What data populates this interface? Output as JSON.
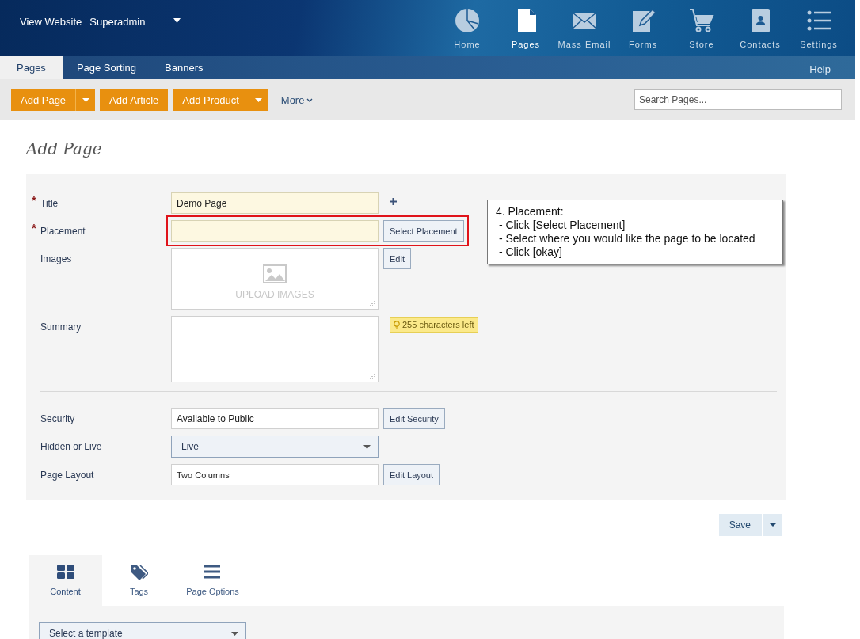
{
  "header": {
    "links": [
      "View Website",
      "Superadmin"
    ],
    "nav": [
      {
        "label": "Home",
        "selected": false
      },
      {
        "label": "Pages",
        "selected": true
      },
      {
        "label": "Mass Email",
        "selected": false
      },
      {
        "label": "Forms",
        "selected": false
      },
      {
        "label": "Store",
        "selected": false
      },
      {
        "label": "Contacts",
        "selected": false
      },
      {
        "label": "Settings",
        "selected": false
      }
    ]
  },
  "subnav": {
    "tabs": [
      {
        "label": "Pages",
        "selected": true
      },
      {
        "label": "Page Sorting",
        "selected": false
      },
      {
        "label": "Banners",
        "selected": false
      }
    ],
    "help": "Help"
  },
  "toolbar": {
    "buttons": [
      {
        "label": "Add Page",
        "split": true
      },
      {
        "label": "Add Article",
        "split": false
      },
      {
        "label": "Add Product",
        "split": true
      }
    ],
    "more": "More",
    "search": {
      "placeholder": "Search Pages..."
    }
  },
  "heading": "Add Page",
  "form": {
    "rows": [
      {
        "kind": "text",
        "label": "Title",
        "required_mark": "*",
        "value": "Demo Page",
        "add": true
      },
      {
        "kind": "text",
        "label": "Placement",
        "required_mark": "*",
        "highlighted": true,
        "button": "Select Placement"
      },
      {
        "kind": "upload",
        "label": "Images",
        "placeholder": "UPLOAD IMAGES",
        "button": "Edit"
      },
      {
        "kind": "textarea",
        "label": "Summary",
        "hint": "255 characters left"
      },
      {
        "kind": "divider"
      },
      {
        "kind": "plain",
        "label": "Security",
        "value": "Available to Public",
        "button": "Edit Security"
      },
      {
        "kind": "select",
        "label": "Hidden or Live",
        "value": "Live"
      },
      {
        "kind": "plain",
        "label": "Page Layout",
        "value": "Two Columns",
        "button": "Edit Layout",
        "small": true
      }
    ]
  },
  "callout": {
    "lines": [
      "4. Placement:",
      " - Click [Select Placement]",
      " - Select where you would like the page to be located",
      " - Click [okay]"
    ]
  },
  "save": "Save",
  "bottom_tabs": [
    {
      "label": "Content",
      "selected": true
    },
    {
      "label": "Tags",
      "selected": false
    },
    {
      "label": "Page Options",
      "selected": false
    }
  ],
  "template_select": "Select a template"
}
